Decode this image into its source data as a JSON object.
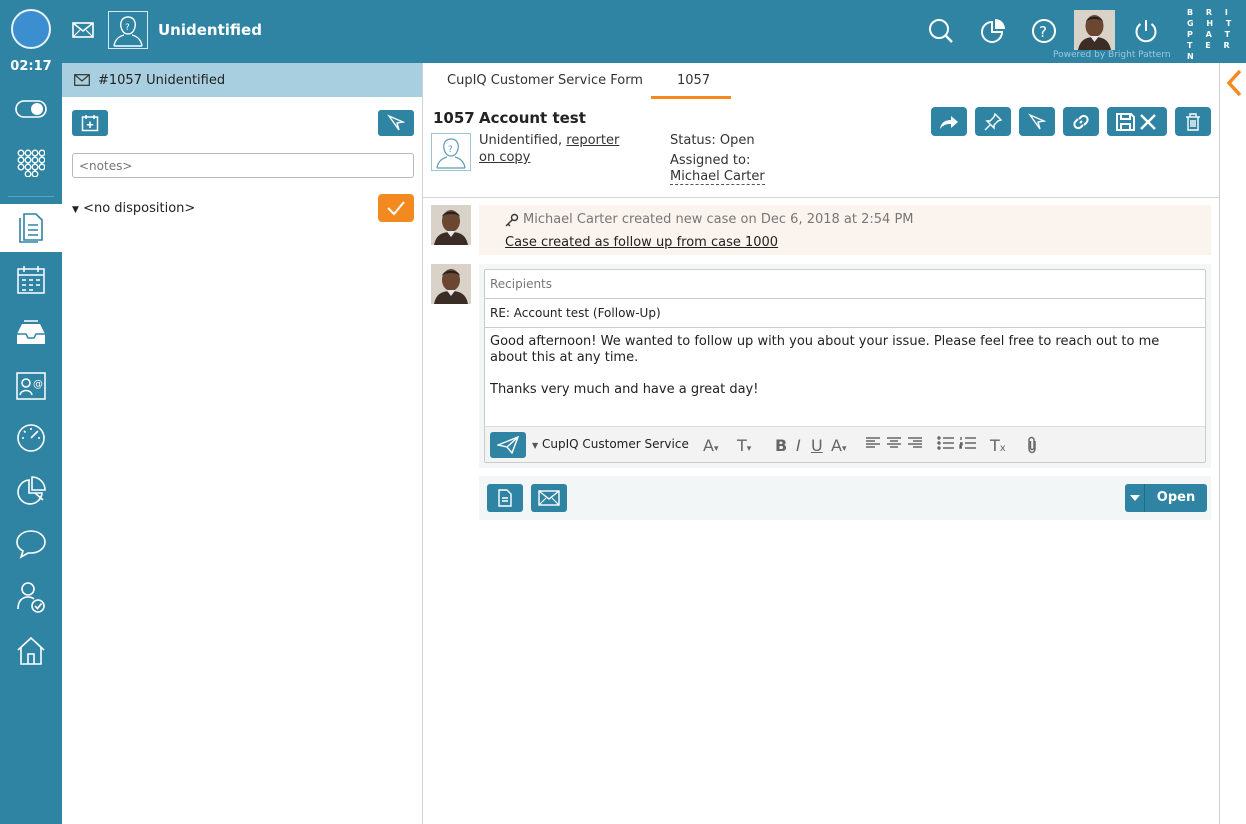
{
  "topbar": {
    "title": "Unidentified",
    "logo_lines": [
      "B R I",
      "G H T",
      "P A T",
      "T E R",
      "N"
    ],
    "powered_by": "Powered by Bright Pattern"
  },
  "leftnav": {
    "timer": "02:17"
  },
  "panel": {
    "header": "#1057 Unidentified",
    "notes_placeholder": "<notes>",
    "disposition": "<no disposition>"
  },
  "main": {
    "tabs": [
      "CupIQ Customer Service Form",
      "1057"
    ],
    "case": {
      "number": "1057",
      "subject": "Account test",
      "contact_name": "Unidentified, ",
      "contact_link1": "reporter",
      "contact_link2": "on copy",
      "status": "Status: Open",
      "assigned_label": "Assigned to:",
      "assigned_name": "Michael Carter"
    },
    "activity": {
      "text": "Michael Carter created new case on Dec 6, 2018 at 2:54 PM",
      "link": "Case created as follow up from case 1000"
    },
    "reply": {
      "recipients_placeholder": "Recipients",
      "subject": "RE: Account test (Follow-Up)",
      "body_line1": "Good afternoon! We wanted to follow up with you about your issue. Please feel free to reach out to me about this at any time.",
      "body_line2": "Thanks very much and have a great day!",
      "sender": "CupIQ Customer Service"
    },
    "open_button": "Open"
  },
  "colors": {
    "primary": "#2f84a4",
    "accent": "#f28a1f",
    "panel_header": "#a7cfdf"
  }
}
